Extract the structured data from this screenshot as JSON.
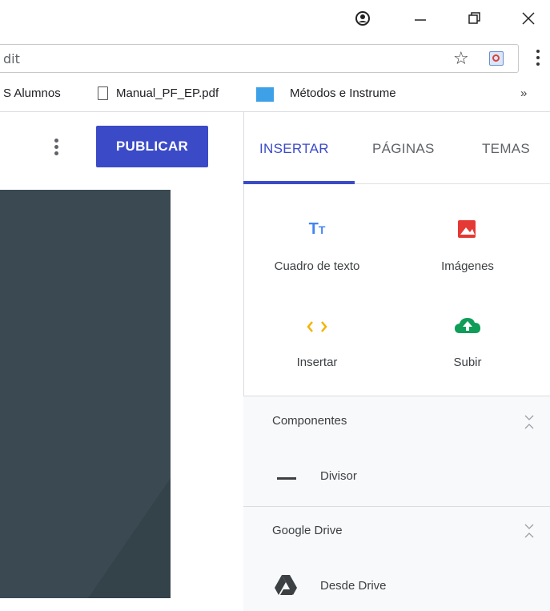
{
  "browser": {
    "url_text": "dit",
    "bookmarks": [
      {
        "label": "S Alumnos"
      },
      {
        "label": "Manual_PF_EP.pdf"
      },
      {
        "label": "Métodos e Instrume"
      }
    ],
    "more_bookmarks": "»"
  },
  "editor": {
    "publish_label": "PUBLICAR"
  },
  "panel": {
    "tabs": [
      {
        "label": "INSERTAR",
        "active": true
      },
      {
        "label": "PÁGINAS",
        "active": false
      },
      {
        "label": "TEMAS",
        "active": false
      }
    ],
    "insert_items": [
      {
        "label": "Cuadro de texto",
        "icon": "text-box-icon"
      },
      {
        "label": "Imágenes",
        "icon": "image-icon"
      },
      {
        "label": "Insertar",
        "icon": "embed-code-icon"
      },
      {
        "label": "Subir",
        "icon": "upload-cloud-icon"
      }
    ],
    "sections": [
      {
        "title": "Componentes",
        "items": [
          {
            "label": "Divisor",
            "icon": "divider-icon"
          }
        ]
      },
      {
        "title": "Google Drive",
        "items": [
          {
            "label": "Desde Drive",
            "icon": "google-drive-icon"
          }
        ]
      }
    ]
  },
  "colors": {
    "accent": "#3b4bc8",
    "text_box_icon": "#4285f4",
    "image_icon": "#e53935",
    "embed_icon": "#f4b400",
    "upload_icon": "#0f9d58",
    "canvas": "#3b4a52"
  }
}
